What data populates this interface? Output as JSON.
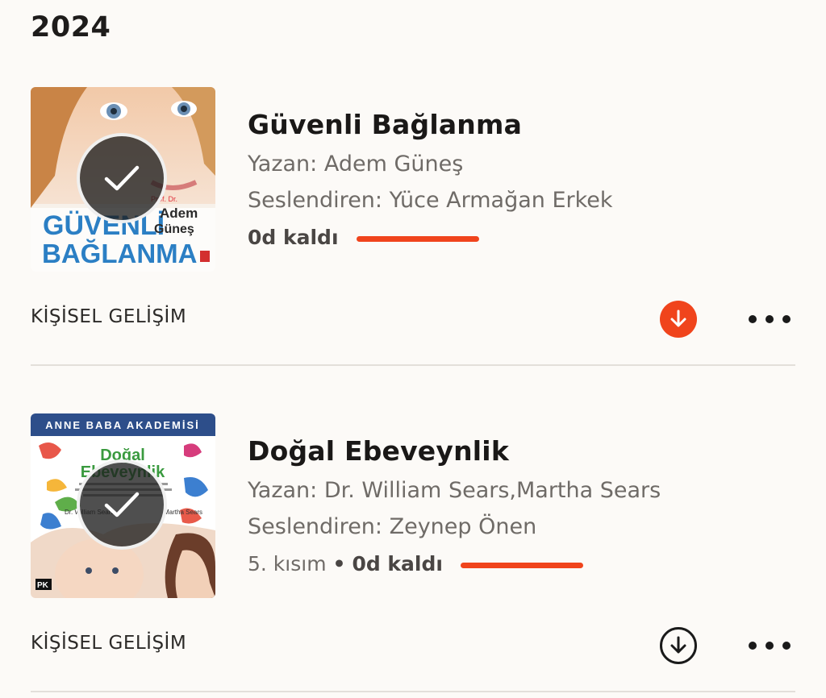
{
  "section": {
    "year": "2024"
  },
  "books": [
    {
      "title": "Güvenli Bağlanma",
      "author": "Yazan: Adem Güneş",
      "narrator": "Seslendiren: Yüce Armağan Erkek",
      "time_left": "0d kaldı",
      "category": "KİŞİSEL GELİŞİM",
      "download_state": "downloading",
      "cover": {
        "line1": "GÜVENLİ",
        "line2": "BAĞLANMA",
        "author_prefix": "Prof. Dr.",
        "author_first": "Adem",
        "author_last": "Güneş"
      }
    },
    {
      "title": "Doğal Ebeveynlik",
      "author": "Yazan: Dr. William Sears,Martha Sears",
      "narrator": "Seslendiren: Zeynep Önen",
      "part": "5. kısım",
      "separator": "•",
      "time_left": "0d kaldı",
      "category": "KİŞİSEL GELİŞİM",
      "download_state": "not-downloaded",
      "cover": {
        "series": "ANNE BABA AKADEMİSİ",
        "line1": "Doğal",
        "line2": "Ebeveynlik",
        "author_left": "Dr. William Sears",
        "author_right": "Martha Sears",
        "publisher": "PK"
      }
    }
  ],
  "icons": {
    "check": "check-icon",
    "download": "download-arrow-icon",
    "more": "more-horizontal-icon"
  },
  "colors": {
    "accent": "#f0441c",
    "background": "#fcfaf7",
    "text_primary": "#1a1817",
    "text_secondary": "#6f6b67"
  }
}
